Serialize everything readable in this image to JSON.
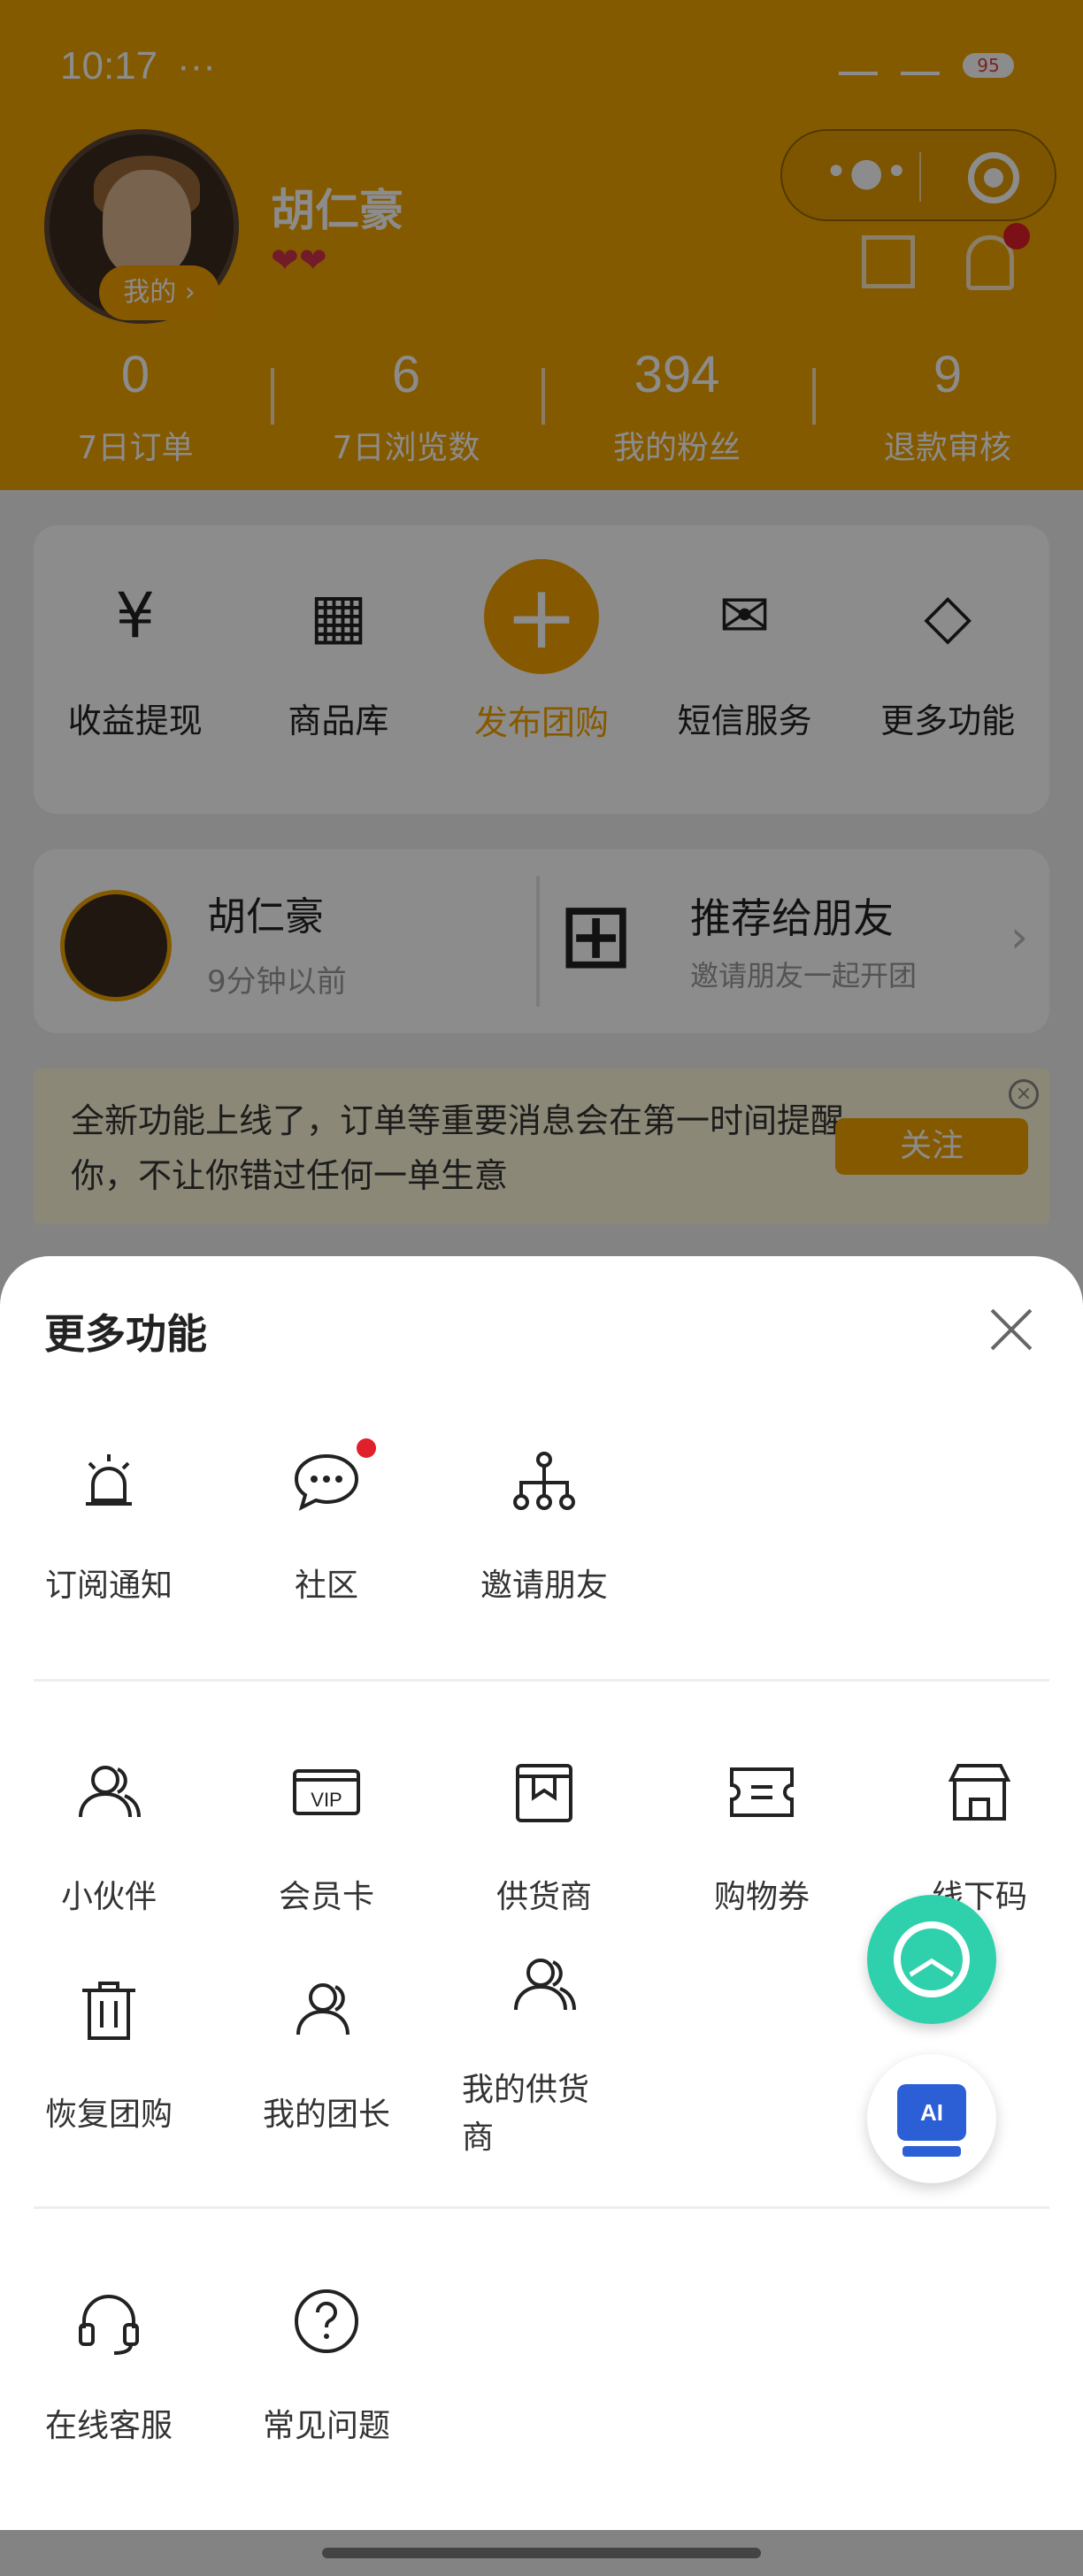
{
  "status_bar": {
    "time": "10:17",
    "extra": "···",
    "battery": "95"
  },
  "header": {
    "user_name": "胡仁豪",
    "my_badge": "我的 ›",
    "hearts": "❤❤",
    "stats": [
      {
        "value": "0",
        "label": "7日订单"
      },
      {
        "value": "6",
        "label": "7日浏览数"
      },
      {
        "value": "394",
        "label": "我的粉丝"
      },
      {
        "value": "9",
        "label": "退款审核"
      }
    ]
  },
  "quick_actions": [
    {
      "label": "收益提现",
      "icon": "yen-withdraw-icon"
    },
    {
      "label": "商品库",
      "icon": "grid-icon"
    },
    {
      "label": "发布团购",
      "icon": "plus-icon"
    },
    {
      "label": "短信服务",
      "icon": "mail-icon"
    },
    {
      "label": "更多功能",
      "icon": "more-apps-icon"
    }
  ],
  "recent": {
    "name": "胡仁豪",
    "time": "9分钟以前",
    "recommend_title": "推荐给朋友",
    "recommend_sub": "邀请朋友一起开团"
  },
  "notice": {
    "text": "全新功能上线了，订单等重要消息会在第一时间提醒你，不让你错过任何一单生意",
    "button": "关注"
  },
  "sheet": {
    "title": "更多功能",
    "group1": [
      {
        "label": "订阅通知",
        "icon": "alarm-light-icon"
      },
      {
        "label": "社区",
        "icon": "chat-bubble-icon",
        "badge": true
      },
      {
        "label": "邀请朋友",
        "icon": "org-tree-icon"
      }
    ],
    "group2": [
      {
        "label": "小伙伴",
        "icon": "users-icon"
      },
      {
        "label": "会员卡",
        "icon": "vip-card-icon"
      },
      {
        "label": "供货商",
        "icon": "bookmark-box-icon"
      },
      {
        "label": "购物券",
        "icon": "coupon-icon"
      },
      {
        "label": "线下码",
        "icon": "store-icon"
      },
      {
        "label": "恢复团购",
        "icon": "trash-icon"
      },
      {
        "label": "我的团长",
        "icon": "user-icon"
      },
      {
        "label": "我的供货商",
        "icon": "users-icon"
      }
    ],
    "group3": [
      {
        "label": "在线客服",
        "icon": "headset-icon"
      },
      {
        "label": "常见问题",
        "icon": "question-circle-icon"
      }
    ]
  },
  "fab": {
    "ai_label": "AI"
  },
  "colors": {
    "accent": "#f5a300",
    "teal": "#2ed1ac",
    "badge_red": "#e0202a"
  }
}
